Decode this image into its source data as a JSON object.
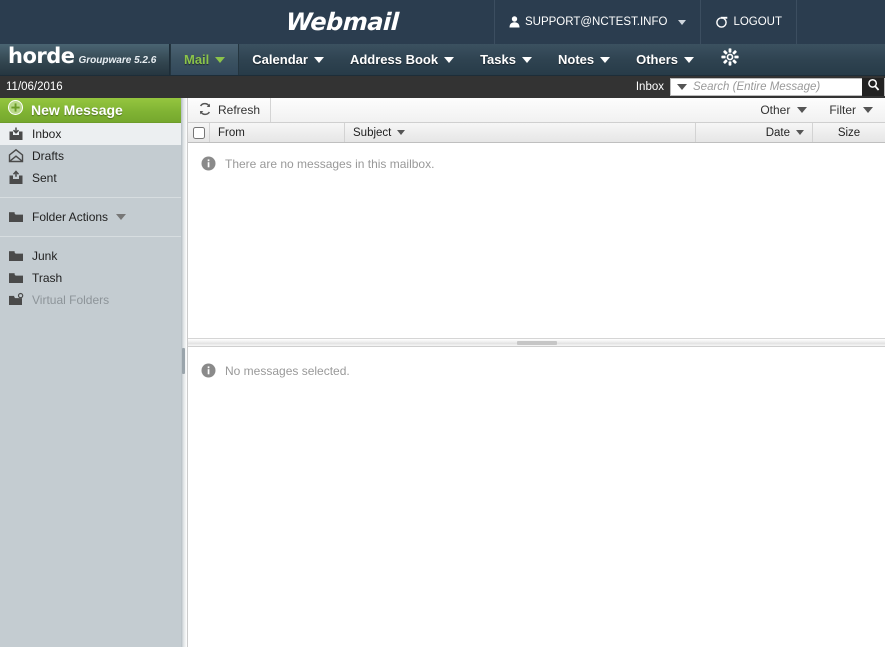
{
  "brand": {
    "logo_text": "Webmail",
    "user_email": "SUPPORT@NCTEST.INFO",
    "user_icon": "person-icon",
    "user_caret": "chevron-down-icon",
    "logout_label": "LOGOUT",
    "logout_icon": "logout-icon",
    "bg_color": "#2b3d4f"
  },
  "nav": {
    "product_name": "horde",
    "product_version": "Groupware 5.2.6",
    "active_color": "#8bc34a",
    "items": [
      {
        "label": "Mail",
        "active": true,
        "has_caret": true
      },
      {
        "label": "Calendar",
        "active": false,
        "has_caret": true
      },
      {
        "label": "Address Book",
        "active": false,
        "has_caret": true
      },
      {
        "label": "Tasks",
        "active": false,
        "has_caret": true
      },
      {
        "label": "Notes",
        "active": false,
        "has_caret": true
      },
      {
        "label": "Others",
        "active": false,
        "has_caret": true
      }
    ],
    "settings_icon": "gear-icon"
  },
  "search": {
    "date": "11/06/2016",
    "mailbox_label": "Inbox",
    "placeholder": "Search (Entire Message)",
    "value": "",
    "dropdown_icon": "chevron-down-icon",
    "search_icon": "magnifier-icon"
  },
  "sidebar": {
    "new_message_label": "New Message",
    "new_message_icon": "plus-circle-icon",
    "new_message_color": "#7fb233",
    "bg_color": "#c4ccd1",
    "folders": [
      {
        "label": "Inbox",
        "icon": "inbox-icon",
        "selected": true,
        "muted": false
      },
      {
        "label": "Drafts",
        "icon": "drafts-envelope-icon",
        "selected": false,
        "muted": false
      },
      {
        "label": "Sent",
        "icon": "sent-icon",
        "selected": false,
        "muted": false
      }
    ],
    "folder_actions_label": "Folder Actions",
    "folder_actions_icon": "folder-icon",
    "folder_actions_caret": "chevron-down-icon",
    "special_folders": [
      {
        "label": "Junk",
        "icon": "folder-icon",
        "muted": false
      },
      {
        "label": "Trash",
        "icon": "folder-icon",
        "muted": false
      },
      {
        "label": "Virtual Folders",
        "icon": "virtual-folder-icon",
        "muted": true
      }
    ]
  },
  "toolbar": {
    "refresh_label": "Refresh",
    "refresh_icon": "refresh-icon",
    "other_label": "Other",
    "filter_label": "Filter"
  },
  "columns": {
    "from": "From",
    "subject": "Subject",
    "date": "Date",
    "size": "Size"
  },
  "messages": {
    "empty_text": "There are no messages in this mailbox.",
    "empty_icon": "info-icon",
    "rows": []
  },
  "preview": {
    "empty_text": "No messages selected.",
    "empty_icon": "info-icon"
  }
}
